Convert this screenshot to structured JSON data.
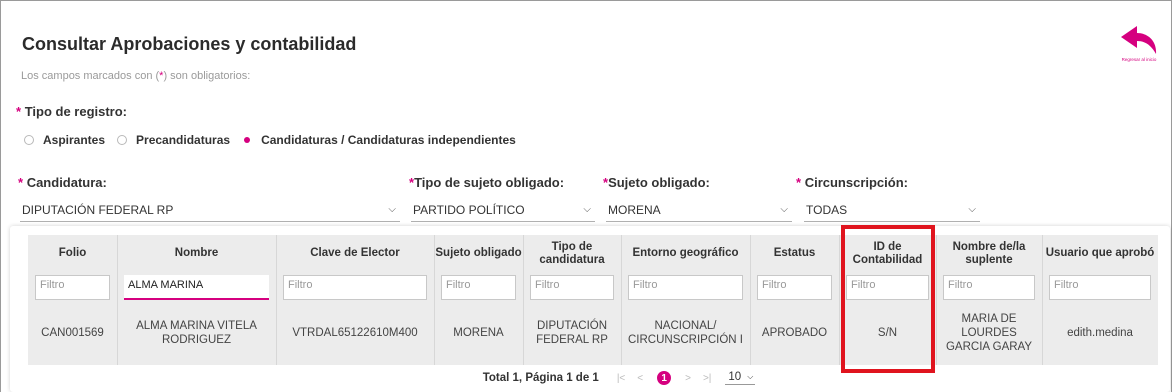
{
  "header": {
    "title": "Consultar Aprobaciones y contabilidad",
    "hint_prefix": "Los campos marcados con (",
    "hint_star": "*",
    "hint_suffix": ") son obligatorios:",
    "back_label": "Regresar al inicio"
  },
  "tipo_registro": {
    "label": "Tipo de registro:",
    "options": [
      {
        "label": "Aspirantes",
        "selected": false
      },
      {
        "label": "Precandidaturas",
        "selected": false
      },
      {
        "label": "Candidaturas / Candidaturas independientes",
        "selected": true
      }
    ]
  },
  "filters": {
    "candidatura": {
      "label": "Candidatura:",
      "value": "DIPUTACIÓN FEDERAL RP"
    },
    "tipo_sujeto": {
      "label": "Tipo de sujeto obligado:",
      "value": "PARTIDO POLÍTICO"
    },
    "sujeto": {
      "label": "Sujeto obligado:",
      "value": "MORENA"
    },
    "circunscripcion": {
      "label": "Circunscripción:",
      "value": "TODAS"
    }
  },
  "table": {
    "columns": [
      {
        "title": "Folio",
        "filter": "Filtro"
      },
      {
        "title": "Nombre",
        "filter": "ALMA MARINA"
      },
      {
        "title": "Clave de Elector",
        "filter": "Filtro"
      },
      {
        "title": "Sujeto obligado",
        "filter": "Filtro"
      },
      {
        "title": "Tipo de candidatura",
        "filter": "Filtro"
      },
      {
        "title": "Entorno geográfico",
        "filter": "Filtro"
      },
      {
        "title": "Estatus",
        "filter": "Filtro"
      },
      {
        "title": "ID de Contabilidad",
        "filter": "Filtro"
      },
      {
        "title": "Nombre de/la suplente",
        "filter": "Filtro"
      },
      {
        "title": "Usuario que aprobó",
        "filter": "Filtro"
      }
    ],
    "rows": [
      [
        "CAN001569",
        "ALMA MARINA VITELA RODRIGUEZ",
        "VTRDAL65122610M400",
        "MORENA",
        "DIPUTACIÓN FEDERAL RP",
        "NACIONAL/ CIRCUNSCRIPCIÓN I",
        "APROBADO",
        "S/N",
        "MARIA DE LOURDES GARCIA GARAY",
        "edith.medina"
      ]
    ]
  },
  "pagination": {
    "summary": "Total 1, Página 1 de 1",
    "current_page": "1",
    "page_size": "10"
  },
  "colors": {
    "accent": "#d5007f",
    "highlight": "#e0141e",
    "table_bg": "#ececec"
  }
}
